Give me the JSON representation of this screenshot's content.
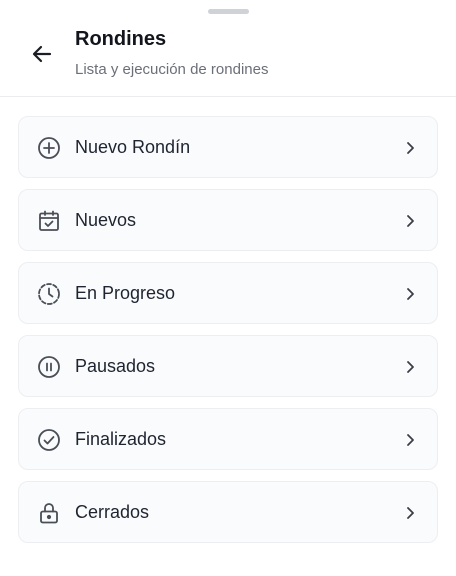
{
  "header": {
    "title": "Rondines",
    "subtitle": "Lista y ejecución de rondines"
  },
  "menu": {
    "items": [
      {
        "label": "Nuevo Rondín",
        "icon": "plus-circle-icon"
      },
      {
        "label": "Nuevos",
        "icon": "calendar-check-icon"
      },
      {
        "label": "En Progreso",
        "icon": "clock-dashed-icon"
      },
      {
        "label": "Pausados",
        "icon": "pause-circle-icon"
      },
      {
        "label": "Finalizados",
        "icon": "check-circle-icon"
      },
      {
        "label": "Cerrados",
        "icon": "lock-icon"
      }
    ]
  },
  "colors": {
    "text": "#1f2430",
    "muted": "#6b6f78",
    "card_bg": "#fafbfc",
    "card_border": "#eceef1",
    "icon": "#4a4e57"
  }
}
